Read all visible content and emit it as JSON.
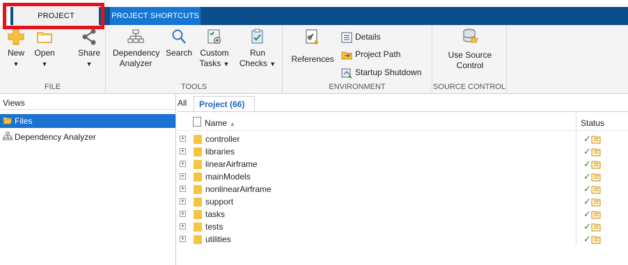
{
  "tabs": [
    {
      "label": "PROJECT"
    },
    {
      "label": "PROJECT SHORTCUTS"
    }
  ],
  "ribbon": {
    "file": {
      "label": "FILE",
      "new": "New",
      "open": "Open",
      "share": "Share"
    },
    "tools": {
      "label": "TOOLS",
      "dependency_line1": "Dependency",
      "dependency_line2": "Analyzer",
      "search": "Search",
      "custom_line1": "Custom",
      "custom_line2": "Tasks",
      "run_line1": "Run",
      "run_line2": "Checks"
    },
    "environment": {
      "label": "ENVIRONMENT",
      "references": "References",
      "details": "Details",
      "project_path": "Project Path",
      "startup_shutdown": "Startup Shutdown"
    },
    "source_control": {
      "label": "SOURCE CONTROL",
      "use_line1": "Use Source",
      "use_line2": "Control"
    }
  },
  "views": {
    "header": "Views",
    "items": [
      {
        "label": "Files",
        "icon": "folder-open-icon",
        "selected": true
      },
      {
        "label": "Dependency Analyzer",
        "icon": "dependency-tree-icon",
        "selected": false
      }
    ]
  },
  "project_panel": {
    "tab_all": "All",
    "tab_project": "Project (66)",
    "columns": {
      "name": "Name",
      "status": "Status"
    },
    "rows": [
      {
        "name": "controller"
      },
      {
        "name": "libraries"
      },
      {
        "name": "linearAirframe"
      },
      {
        "name": "mainModels"
      },
      {
        "name": "nonlinearAirframe"
      },
      {
        "name": "support"
      },
      {
        "name": "tasks"
      },
      {
        "name": "tests"
      },
      {
        "name": "utilities"
      }
    ],
    "status_check": "✓"
  },
  "colors": {
    "tabstrip": "#0a4e8a",
    "active_tab_highlight": "#e8101b",
    "selection": "#1a73d0",
    "folder": "#f5c542",
    "status_ok": "#2a8a2a"
  }
}
